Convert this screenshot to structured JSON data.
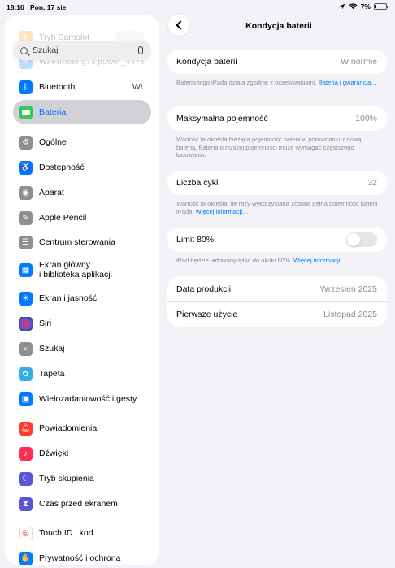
{
  "status": {
    "time": "18:16",
    "date": "Pon. 17 sie",
    "battery": "7%"
  },
  "search": {
    "placeholder": "Szukaj"
  },
  "sidebar": {
    "items": [
      {
        "label": "Tryb Samolot",
        "icon": "airplane-icon",
        "color": "#ff9500"
      },
      {
        "label": "Wi-Fi",
        "value": "moto g73 power_4476",
        "icon": "wifi-icon",
        "color": "#007aff"
      },
      {
        "label": "Bluetooth",
        "value": "Wł.",
        "icon": "bluetooth-icon",
        "color": "#007aff"
      },
      {
        "label": "Bateria",
        "icon": "battery-icon",
        "color": "#34c759"
      },
      {
        "label": "Ogólne",
        "icon": "gear-icon",
        "color": "#8e8e93"
      },
      {
        "label": "Dostępność",
        "icon": "accessibility-icon",
        "color": "#007aff"
      },
      {
        "label": "Aparat",
        "icon": "camera-icon",
        "color": "#8e8e93"
      },
      {
        "label": "Apple Pencil",
        "icon": "pencil-icon",
        "color": "#8e8e93"
      },
      {
        "label": "Centrum sterowania",
        "icon": "control-center-icon",
        "color": "#8e8e93"
      },
      {
        "label": "Ekran główny",
        "label2": "i biblioteka aplikacji",
        "icon": "home-screen-icon",
        "color": "#007aff"
      },
      {
        "label": "Ekran i jasność",
        "icon": "brightness-icon",
        "color": "#007aff"
      },
      {
        "label": "Siri",
        "icon": "siri-icon",
        "color": "#222222"
      },
      {
        "label": "Szukaj",
        "icon": "search-icon",
        "color": "#8e8e93"
      },
      {
        "label": "Tapeta",
        "icon": "wallpaper-icon",
        "color": "#32ade6"
      },
      {
        "label": "Wielozadaniowość i gesty",
        "icon": "multitasking-icon",
        "color": "#007aff"
      },
      {
        "label": "Powiadomienia",
        "icon": "notifications-icon",
        "color": "#ff3b30"
      },
      {
        "label": "Dźwięki",
        "icon": "sounds-icon",
        "color": "#ff2d55"
      },
      {
        "label": "Tryb skupienia",
        "icon": "focus-icon",
        "color": "#5856d6"
      },
      {
        "label": "Czas przed ekranem",
        "icon": "screen-time-icon",
        "color": "#5856d6"
      },
      {
        "label": "Touch ID i kod",
        "icon": "fingerprint-icon",
        "color": "#ff3b30"
      },
      {
        "label": "Prywatność i ochrona",
        "icon": "privacy-icon",
        "color": "#007aff"
      }
    ]
  },
  "detail": {
    "title": "Kondycja baterii",
    "health": {
      "label": "Kondycja baterii",
      "value": "W normie"
    },
    "health_footer": "Bateria tego iPada działa zgodnie z oczekiwaniami. ",
    "health_footer_link": "Bateria i gwarancja…",
    "capacity": {
      "label": "Maksymalna pojemność",
      "value": "100%"
    },
    "capacity_footer": "Wartość ta określa bieżącą pojemność baterii w porównaniu z nową baterią. Bateria o niższej pojemności może wymagać częstszego ładowania.",
    "cycles": {
      "label": "Liczba cykli",
      "value": "32"
    },
    "cycles_footer": "Wartość ta określa, ile razy wykorzystana została pełna pojemność baterii iPada. ",
    "cycles_footer_link": "Więcej informacji…",
    "limit": {
      "label": "Limit 80%",
      "on": false
    },
    "limit_footer": "iPad będzie ładowany tylko do około 80%. ",
    "limit_footer_link": "Więcej informacji…",
    "production": {
      "label": "Data produkcji",
      "value": "Wrzesień 2025"
    },
    "first_use": {
      "label": "Pierwsze użycie",
      "value": "Listopad 2025"
    }
  }
}
